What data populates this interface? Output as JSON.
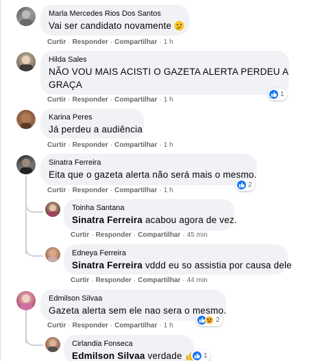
{
  "actions": {
    "like": "Curtir",
    "reply": "Responder",
    "share": "Compartilhar"
  },
  "comments": [
    {
      "author": "Marla Mercedes Rios Dos Santos",
      "text": "Vai ser candidato novamente",
      "emoji": "thinking-face",
      "time": "1 h"
    },
    {
      "author": "Hilda Sales",
      "text_line1": "NÃO VOU MAIS ACISTI O GAZETA ALERTA PERDEU A",
      "text_line2": "GRAÇA",
      "time": "1 h",
      "reactions": "1"
    },
    {
      "author": "Karina Peres",
      "text": "Já perdeu a audiência",
      "time": "1 h"
    },
    {
      "author": "Sinatra Ferreira",
      "text": "Eita que o gazeta alerta não será mais o mesmo.",
      "time": "1 h",
      "reactions": "2"
    },
    {
      "author": "Toinha Santana",
      "mention": "Sinatra Ferreira",
      "text": "acabou agora de vez.",
      "time": "45 min"
    },
    {
      "author": "Edneya Ferreira",
      "mention": "Sinatra Ferreira",
      "text": "vddd eu so assistia por causa dele",
      "time": "44 min"
    },
    {
      "author": "Edmilson Silvaa",
      "text": "Gazeta alerta sem ele nao sera o mesmo.",
      "time": "1 h",
      "reactions": "2"
    },
    {
      "author": "Cirlandia Fonseca",
      "mention": "Edmilson Silvaa",
      "text": "verdade",
      "emoji": "thumbs-up",
      "reactions": "1"
    }
  ],
  "colors": {
    "bubble": "#f0f2f5",
    "meta": "#65676b",
    "like": "#1877f2",
    "haha": "#f7b125"
  }
}
